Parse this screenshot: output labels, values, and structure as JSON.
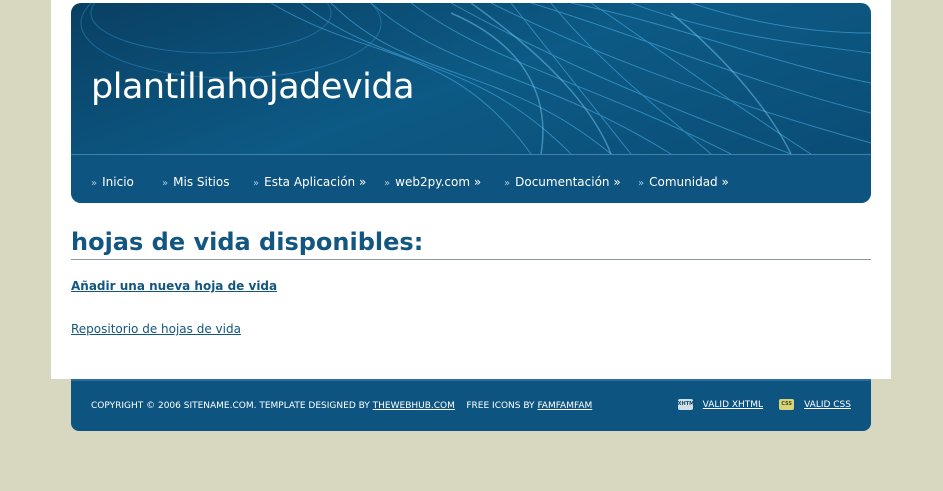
{
  "header": {
    "site_title": "plantillahojadevida"
  },
  "nav": {
    "items": [
      {
        "label": "Inicio"
      },
      {
        "label": "Mis Sitios"
      },
      {
        "label": "Esta Aplicación »"
      },
      {
        "label": "web2py.com »"
      },
      {
        "label": "Documentación »"
      },
      {
        "label": "Comunidad »"
      }
    ]
  },
  "main": {
    "heading": "hojas de vida disponibles:",
    "add_link": "Añadir una nueva hoja de vida",
    "repo_link": "Repositorio de hojas de vida"
  },
  "footer": {
    "copyright_text": "COPYRIGHT © 2006 SITENAME.COM. TEMPLATE DESIGNED BY",
    "designer_link": "THEWEBHUB.COM",
    "icons_text": "FREE ICONS BY",
    "icons_link": "FAMFAMFAM",
    "xhtml_link": "VALID XHTML",
    "css_link": "VALID CSS",
    "xhtml_icon_text": "XHTML",
    "css_icon_text": "CSS"
  },
  "colors": {
    "background": "#d8d8c0",
    "header_blue": "#0c5a85",
    "nav_blue": "#0d5580",
    "heading_text": "#13567f"
  }
}
